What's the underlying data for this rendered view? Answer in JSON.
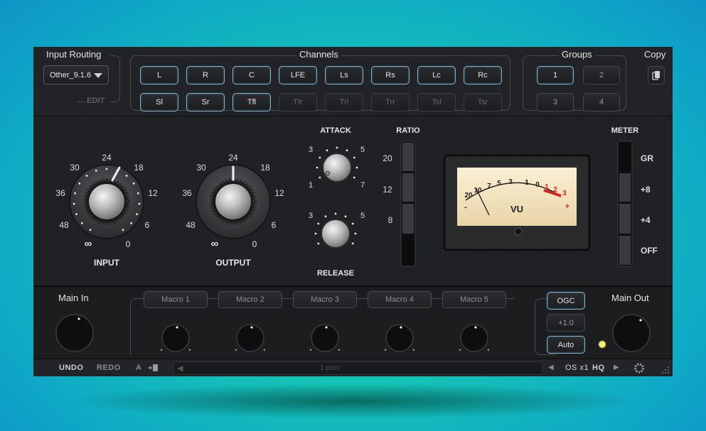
{
  "input_routing": {
    "title": "Input Routing",
    "selected": "Other_9.1.6",
    "edit_label": "EDIT"
  },
  "channels": {
    "title": "Channels",
    "row1": [
      "L",
      "R",
      "C",
      "LFE",
      "Ls",
      "Rs",
      "Lc",
      "Rc"
    ],
    "row2": [
      "Sl",
      "Sr",
      "Tfl",
      "Tfr",
      "Trl",
      "Trr",
      "Tsl",
      "Tsr"
    ]
  },
  "groups": {
    "title": "Groups",
    "buttons": [
      "1",
      "2",
      "3",
      "4"
    ]
  },
  "copy": {
    "title": "Copy",
    "icon": "copy-icon"
  },
  "input_knob": {
    "label": "INPUT",
    "scale": [
      "24",
      "18",
      "12",
      "6",
      "0",
      "∞",
      "48",
      "36",
      "30"
    ]
  },
  "output_knob": {
    "label": "OUTPUT",
    "scale": [
      "24",
      "18",
      "12",
      "6",
      "0",
      "∞",
      "48",
      "36",
      "30"
    ]
  },
  "attack": {
    "label": "ATTACK",
    "scale": [
      "3",
      "5",
      "1",
      "7"
    ]
  },
  "release": {
    "label": "RELEASE",
    "scale": [
      "3",
      "5"
    ]
  },
  "ratio": {
    "label": "RATIO",
    "values": [
      "20",
      "12",
      "8"
    ]
  },
  "vu_meter": {
    "label": "VU",
    "scale_top": [
      "20",
      "10",
      "7",
      "5",
      "3",
      "1",
      "0",
      "1",
      "2",
      "3"
    ],
    "minus": "-",
    "plus": "+"
  },
  "meter": {
    "label": "METER",
    "options": [
      "GR",
      "+8",
      "+4",
      "OFF"
    ]
  },
  "main_in": {
    "label": "Main In"
  },
  "macros": [
    "Macro 1",
    "Macro 2",
    "Macro 3",
    "Macro 4",
    "Macro 5"
  ],
  "main_out": {
    "label": "Main Out",
    "ogc": "OGC",
    "gain": "+1.0",
    "auto": "Auto"
  },
  "footer": {
    "undo": "UNDO",
    "redo": "REDO",
    "ab": "A",
    "preset": "1 pres",
    "oversampling": "OS x1",
    "hq": "HQ"
  },
  "colors": {
    "accent_border": "#7db6d6",
    "vu_face": "#f2e3c2",
    "vu_red": "#d42424",
    "led": "#f2ef7a"
  }
}
